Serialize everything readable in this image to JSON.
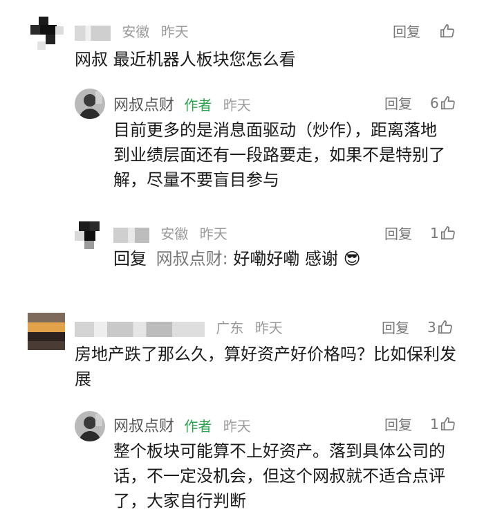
{
  "comments": [
    {
      "location": "安徽",
      "time": "昨天",
      "reply_label": "回复",
      "like_count": "",
      "text": "网叔  最近机器人板块您怎么看",
      "replies": [
        {
          "author": "网叔点财",
          "badge": "作者",
          "time": "昨天",
          "reply_label": "回复",
          "like_count": "6",
          "text": "目前更多的是消息面驱动（炒作），距离落地到业绩层面还有一段路要走，如果不是特别了解，尽量不要盲目参与"
        },
        {
          "location": "安徽",
          "time": "昨天",
          "reply_label": "回复",
          "like_count": "1",
          "prefix": "回复",
          "mention": "网叔点财:",
          "text": "好嘞好嘞  感谢",
          "emoji": "😎"
        }
      ]
    },
    {
      "location": "广东",
      "time": "昨天",
      "reply_label": "回复",
      "like_count": "3",
      "text": "房地产跌了那么久，算好资产好价格吗？比如保利发展",
      "replies": [
        {
          "author": "网叔点财",
          "badge": "作者",
          "time": "昨天",
          "reply_label": "回复",
          "like_count": "1",
          "text": "整个板块可能算不上好资产。落到具体公司的话，不一定没机会，但这个网叔就不适合点评了，大家自行判断"
        }
      ]
    }
  ],
  "icons": {
    "like": "thumbs-up-icon"
  },
  "colors": {
    "author_badge": "#2aa34a",
    "meta": "#9a9a9a"
  }
}
